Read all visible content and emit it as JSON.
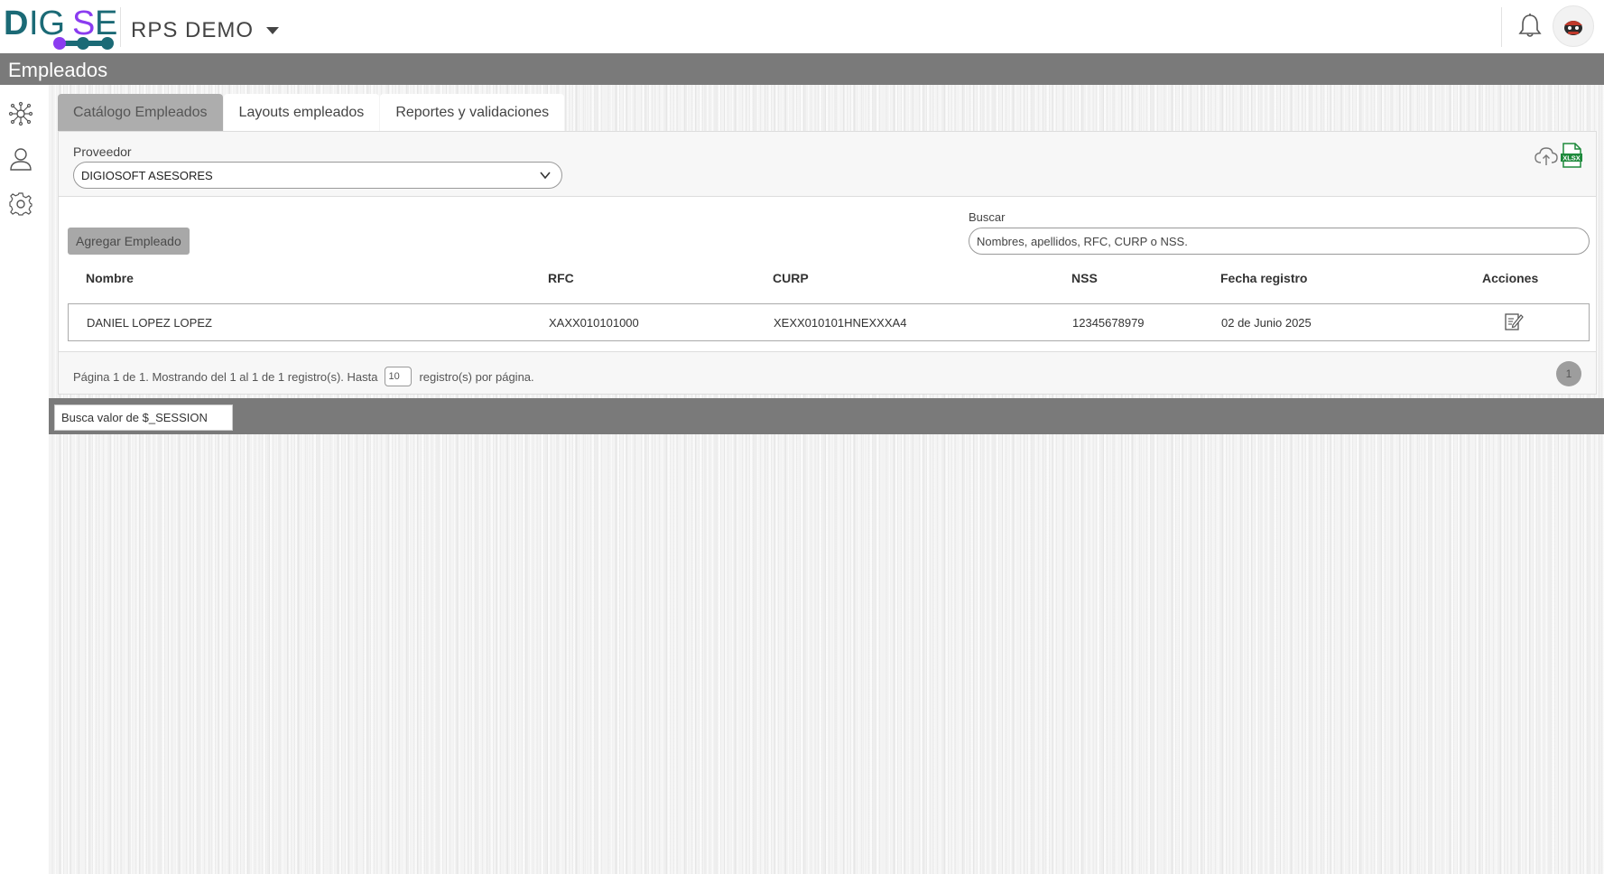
{
  "header": {
    "logo_text": "DIGSE",
    "company_name": "RPS DEMO"
  },
  "section": {
    "title": "Empleados"
  },
  "sidebar": {
    "items": [
      {
        "icon": "network-icon"
      },
      {
        "icon": "user-icon"
      },
      {
        "icon": "gear-icon"
      }
    ]
  },
  "tabs": [
    {
      "label": "Catálogo Empleados",
      "active": true
    },
    {
      "label": "Layouts empleados",
      "active": false
    },
    {
      "label": "Reportes y validaciones",
      "active": false
    }
  ],
  "provider": {
    "label": "Proveedor",
    "selected": "DIGIOSOFT ASESORES"
  },
  "toolbar": {
    "add_label": "Agregar Empleado",
    "search_label": "Buscar",
    "search_placeholder": "Nombres, apellidos, RFC, CURP o NSS."
  },
  "table": {
    "columns": [
      "Nombre",
      "RFC",
      "CURP",
      "NSS",
      "Fecha registro",
      "Acciones"
    ],
    "rows": [
      {
        "nombre": "DANIEL LOPEZ LOPEZ",
        "rfc": "XAXX010101000",
        "curp": "XEXX010101HNEXXXA4",
        "nss": "12345678979",
        "fecha": "02 de Junio 2025"
      }
    ]
  },
  "pager": {
    "text_before": "Página 1 de 1. Mostrando del 1 al 1 de 1 registro(s). Hasta",
    "page_size": "10",
    "text_after": "registro(s) por página.",
    "current_page": "1"
  },
  "debug": {
    "placeholder": "Busca valor de $_SESSION"
  },
  "colors": {
    "band": "#7a7a7a",
    "active_tab": "#adadad",
    "logo_teal": "#1b6a76",
    "logo_purple": "#8b3cf0",
    "excel_green": "#1e8a3c"
  }
}
